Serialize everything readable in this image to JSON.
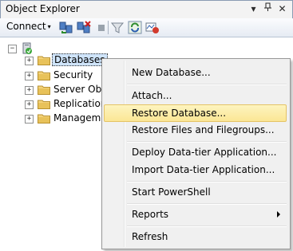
{
  "window": {
    "title": "Object Explorer",
    "pin_glyph": "▾",
    "autohide_glyph": "⊣",
    "close_glyph": "✕"
  },
  "toolbar": {
    "connect_label": "Connect",
    "connect_caret": "▾",
    "icons": [
      "connect-object-explorer-icon",
      "disconnect-icon",
      "stop-icon",
      "filter-icon",
      "refresh-icon",
      "activity-monitor-icon"
    ]
  },
  "tree": {
    "server_icon": "server-icon",
    "collapse_glyph": "−",
    "expand_glyph": "+",
    "nodes": [
      {
        "label": "Databases",
        "selected": true
      },
      {
        "label": "Security",
        "selected": false
      },
      {
        "label": "Server Obje",
        "selected": false
      },
      {
        "label": "Replication",
        "selected": false
      },
      {
        "label": "Manageme",
        "selected": false
      }
    ]
  },
  "context_menu": {
    "items": [
      {
        "label": "New Database...",
        "highlighted": false
      },
      {
        "label": "Attach...",
        "highlighted": false
      },
      {
        "label": "Restore Database...",
        "highlighted": true
      },
      {
        "label": "Restore Files and Filegroups...",
        "highlighted": false
      },
      {
        "label": "Deploy Data-tier Application...",
        "highlighted": false
      },
      {
        "label": "Import Data-tier Application...",
        "highlighted": false
      },
      {
        "label": "Start PowerShell",
        "highlighted": false
      },
      {
        "label": "Reports",
        "highlighted": false,
        "submenu": true
      },
      {
        "label": "Refresh",
        "highlighted": false
      }
    ]
  },
  "colors": {
    "highlight": "#fbe695",
    "selection": "#cfe4fa",
    "folder": "#e8c25a"
  }
}
